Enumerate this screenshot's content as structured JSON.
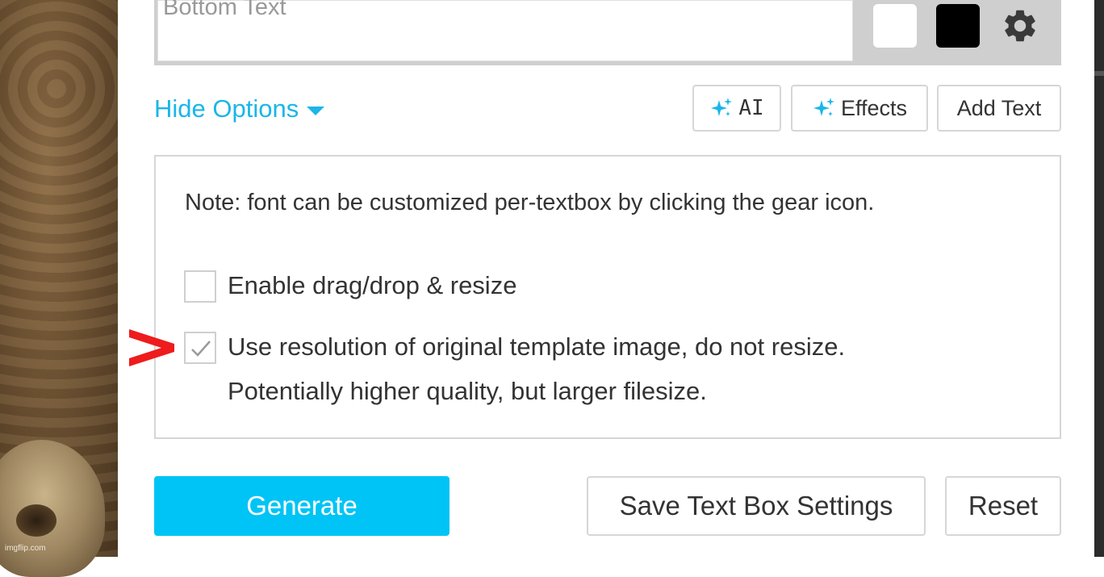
{
  "background": {
    "watermark": "imgflip.com"
  },
  "textbox": {
    "placeholder": "Bottom Text",
    "color_white": "#ffffff",
    "color_black": "#000000",
    "settings_icon": "gear-icon"
  },
  "options_toggle": {
    "label": "Hide Options",
    "icon": "caret-down-icon",
    "color": "#1ab6e8"
  },
  "toolbar": {
    "ai_label": "AI",
    "effects_label": "Effects",
    "add_text_label": "Add Text",
    "sparkle_icon": "sparkle-icon",
    "sparkle_color": "#1ab6e8"
  },
  "options": {
    "note": "Note: font can be customized per-textbox by clicking the gear icon.",
    "drag_drop": {
      "label": "Enable drag/drop & resize",
      "checked": false
    },
    "original_resolution": {
      "label": "Use resolution of original template image, do not resize.",
      "sublabel": "Potentially higher quality, but larger filesize.",
      "checked": true
    }
  },
  "annotation": {
    "icon": "red-arrow-icon",
    "color": "#ee1c1c"
  },
  "actions": {
    "generate_label": "Generate",
    "save_label": "Save Text Box Settings",
    "reset_label": "Reset",
    "generate_color": "#00c4f5"
  }
}
